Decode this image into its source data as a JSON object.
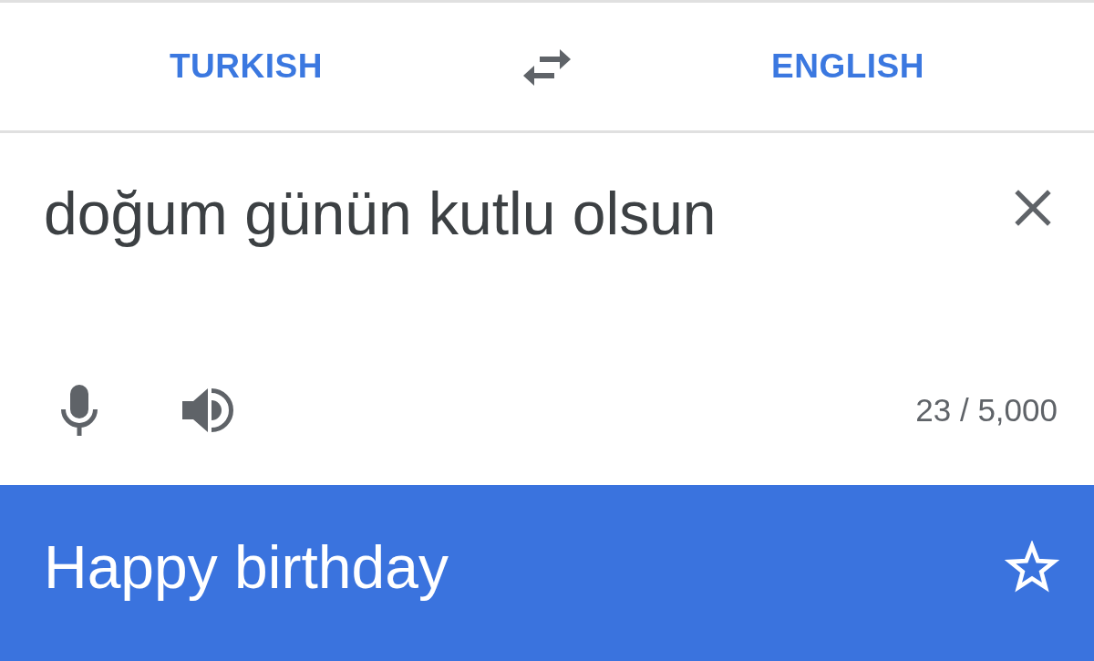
{
  "language_bar": {
    "source_language": "TURKISH",
    "target_language": "ENGLISH"
  },
  "input": {
    "value": "doğum günün kutlu olsun",
    "char_count": "23 / 5,000"
  },
  "translation": {
    "text": "Happy birthday",
    "starred": false
  }
}
